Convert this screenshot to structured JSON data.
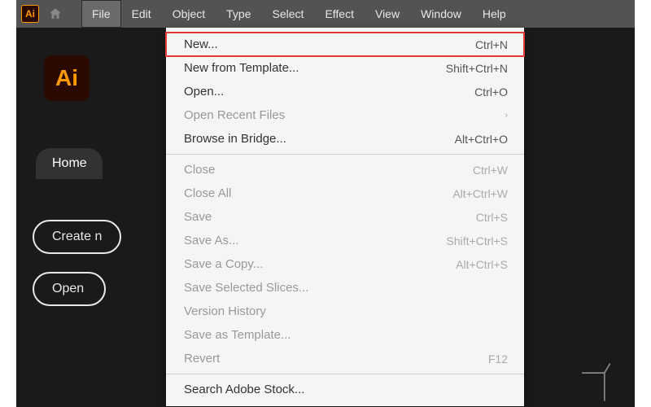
{
  "app_icon_text": "Ai",
  "logo_text": "Ai",
  "menubar": {
    "items": [
      "File",
      "Edit",
      "Object",
      "Type",
      "Select",
      "Effect",
      "View",
      "Window",
      "Help"
    ],
    "active_index": 0
  },
  "home_tab": "Home",
  "buttons": {
    "create_new": "Create n",
    "open": "Open"
  },
  "file_menu": {
    "groups": [
      [
        {
          "label": "New...",
          "shortcut": "Ctrl+N",
          "disabled": false,
          "highlighted": true
        },
        {
          "label": "New from Template...",
          "shortcut": "Shift+Ctrl+N",
          "disabled": false
        },
        {
          "label": "Open...",
          "shortcut": "Ctrl+O",
          "disabled": false
        },
        {
          "label": "Open Recent Files",
          "shortcut": "",
          "disabled": true,
          "submenu": true
        },
        {
          "label": "Browse in Bridge...",
          "shortcut": "Alt+Ctrl+O",
          "disabled": false
        }
      ],
      [
        {
          "label": "Close",
          "shortcut": "Ctrl+W",
          "disabled": true
        },
        {
          "label": "Close All",
          "shortcut": "Alt+Ctrl+W",
          "disabled": true
        },
        {
          "label": "Save",
          "shortcut": "Ctrl+S",
          "disabled": true
        },
        {
          "label": "Save As...",
          "shortcut": "Shift+Ctrl+S",
          "disabled": true
        },
        {
          "label": "Save a Copy...",
          "shortcut": "Alt+Ctrl+S",
          "disabled": true
        },
        {
          "label": "Save Selected Slices...",
          "shortcut": "",
          "disabled": true
        },
        {
          "label": "Version History",
          "shortcut": "",
          "disabled": true
        },
        {
          "label": "Save as Template...",
          "shortcut": "",
          "disabled": true
        },
        {
          "label": "Revert",
          "shortcut": "F12",
          "disabled": true
        }
      ],
      [
        {
          "label": "Search Adobe Stock...",
          "shortcut": "",
          "disabled": false
        }
      ]
    ]
  }
}
